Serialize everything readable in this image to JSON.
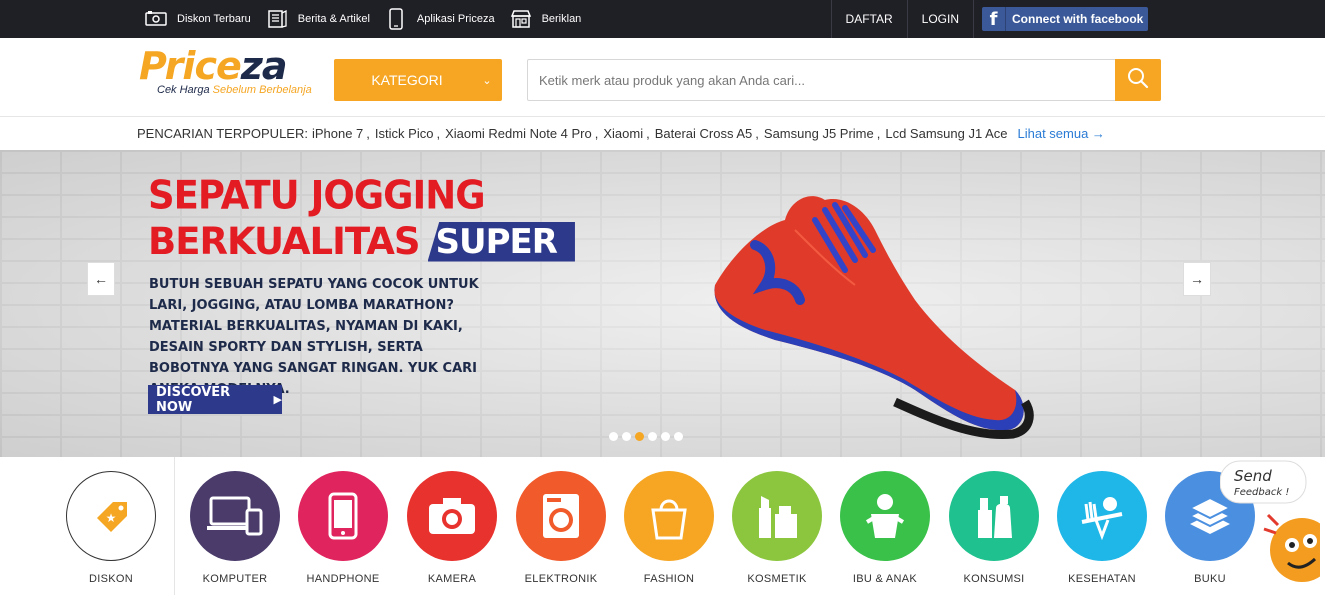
{
  "topbar": {
    "links": [
      {
        "label": "Diskon Terbaru",
        "icon": "discount-ticket-icon"
      },
      {
        "label": "Berita & Artikel",
        "icon": "news-icon"
      },
      {
        "label": "Aplikasi Priceza",
        "icon": "mobile-app-icon"
      },
      {
        "label": "Beriklan",
        "icon": "store-icon"
      }
    ],
    "daftar": "DAFTAR",
    "login": "LOGIN",
    "facebook": "Connect with facebook"
  },
  "header": {
    "logo_part1": "Price",
    "logo_part2": "za",
    "tagline_part1": "Cek Harga ",
    "tagline_part2": "Sebelum Berbelanja",
    "kategori": "KATEGORI",
    "search_placeholder": "Ketik merk atau produk yang akan Anda cari..."
  },
  "popular": {
    "title": "PENCARIAN TERPOPULER:",
    "items": [
      "iPhone 7",
      "Istick Pico",
      "Xiaomi Redmi Note 4 Pro",
      "Xiaomi",
      "Baterai Cross A5",
      "Samsung J5 Prime",
      "Lcd Samsung J1 Ace"
    ],
    "more": "Lihat semua →"
  },
  "banner": {
    "headline1": "SEPATU JOGGING",
    "headline2": "BERKUALITAS",
    "headline_badge": "SUPER",
    "body": "BUTUH SEBUAH SEPATU YANG COCOK UNTUK LARI, JOGGING, ATAU LOMBA MARATHON? MATERIAL BERKUALITAS, NYAMAN DI KAKI, DESAIN SPORTY DAN STYLISH, SERTA BOBOTNYA YANG SANGAT RINGAN. YUK CARI ANEKA MODELNYA.",
    "cta": "DISCOVER NOW",
    "slide_count": 6,
    "active_slide": 3,
    "prev_icon": "←",
    "next_icon": "→"
  },
  "categories": [
    {
      "label": "DISKON",
      "icon": "discount-tag-icon",
      "color": "#ffffff"
    },
    {
      "label": "KOMPUTER",
      "icon": "computer-icon",
      "color": "#4a3b6b"
    },
    {
      "label": "HANDPHONE",
      "icon": "handphone-icon",
      "color": "#e0245e"
    },
    {
      "label": "KAMERA",
      "icon": "camera-icon",
      "color": "#e8322e"
    },
    {
      "label": "ELEKTRONIK",
      "icon": "washing-machine-icon",
      "color": "#f15a2b"
    },
    {
      "label": "FASHION",
      "icon": "handbag-icon",
      "color": "#f6a623"
    },
    {
      "label": "KOSMETIK",
      "icon": "cosmetics-icon",
      "color": "#8cc63f"
    },
    {
      "label": "IBU & ANAK",
      "icon": "baby-icon",
      "color": "#39c14a"
    },
    {
      "label": "KONSUMSI",
      "icon": "bottles-icon",
      "color": "#1fc18e"
    },
    {
      "label": "KESEHATAN",
      "icon": "health-balance-icon",
      "color": "#1fb6e8"
    },
    {
      "label": "BUKU",
      "icon": "books-icon",
      "color": "#4a8fe0"
    }
  ],
  "feedback": {
    "line1": "Send",
    "line2": "Feedback !"
  }
}
